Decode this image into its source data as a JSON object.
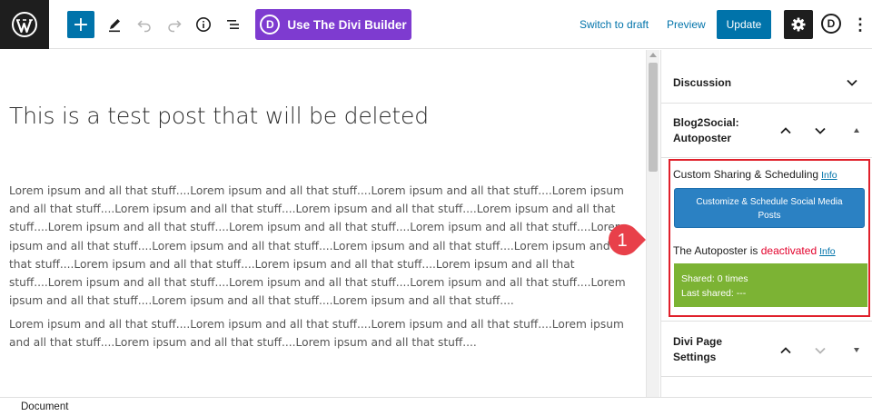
{
  "toolbar": {
    "add_label": "+",
    "divi_badge": "D",
    "divi_label": "Use The Divi Builder",
    "switch_to_draft": "Switch to draft",
    "preview": "Preview",
    "update": "Update",
    "user_badge": "D",
    "more": "⋮"
  },
  "editor": {
    "title": "This is a test post that will be deleted",
    "paragraphs": [
      "Lorem ipsum and all that stuff....Lorem ipsum and all that stuff....Lorem ipsum and all that stuff....Lorem ipsum and all that stuff....Lorem ipsum and all that stuff....Lorem ipsum and all that stuff....Lorem ipsum and all that stuff....Lorem ipsum and all that stuff....Lorem ipsum and all that stuff....Lorem ipsum and all that stuff....Lorem ipsum and all that stuff....Lorem ipsum and all that stuff....Lorem ipsum and all that stuff....Lorem ipsum and all that stuff....Lorem ipsum and all that stuff....Lorem ipsum and all that stuff....Lorem ipsum and all that stuff....Lorem ipsum and all that stuff....Lorem ipsum and all that stuff....Lorem ipsum and all that stuff....Lorem ipsum and all that stuff....Lorem ipsum and all that stuff....Lorem ipsum and all that stuff....",
      "Lorem ipsum and all that stuff....Lorem ipsum and all that stuff....Lorem ipsum and all that stuff....Lorem ipsum and all that stuff....Lorem ipsum and all that stuff....Lorem ipsum and all that stuff...."
    ]
  },
  "sidebar": {
    "discussion": "Discussion",
    "blog2social_title_line1": "Blog2Social:",
    "blog2social_title_line2": "Autoposter",
    "custom_sharing": "Custom Sharing & Scheduling",
    "info": "Info",
    "cta_line1": "Customize & Schedule Social Media",
    "cta_line2": "Posts",
    "autoposter_prefix": "The Autoposter is",
    "autoposter_state": "deactivated",
    "shared_count": "Shared: 0 times",
    "last_shared": "Last shared: ---",
    "divi_settings_line1": "Divi Page",
    "divi_settings_line2": "Settings"
  },
  "callout": {
    "number": "1"
  },
  "status_bar": {
    "label": "Document"
  },
  "colors": {
    "accent": "#0073aa",
    "divi_purple": "#7e3bd0",
    "highlight_red": "#e0202b",
    "shared_green": "#7cb334",
    "callout_red": "#e8404a"
  }
}
